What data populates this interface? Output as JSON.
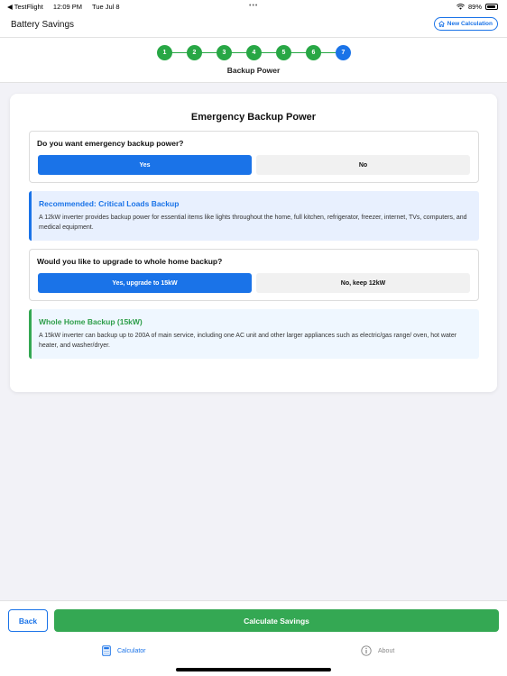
{
  "status_bar": {
    "back_app": "◀ TestFlight",
    "time": "12:09 PM",
    "date": "Tue Jul 8",
    "dots": "•••",
    "battery_pct": "89%",
    "battery_level": 0.89
  },
  "nav": {
    "title": "Battery Savings",
    "new_calc_label": "New Calculation"
  },
  "stepper": {
    "steps": [
      "1",
      "2",
      "3",
      "4",
      "5",
      "6",
      "7"
    ],
    "current_index": 6,
    "current_label": "Backup Power"
  },
  "card": {
    "title": "Emergency Backup Power",
    "q1": {
      "text": "Do you want emergency backup power?",
      "yes": "Yes",
      "no": "No",
      "selected": "Yes"
    },
    "rec": {
      "title": "Recommended: Critical Loads Backup",
      "body": "A 12kW inverter provides backup power for essential items like lights throughout the home, full kitchen, refrigerator, freezer, internet, TVs, computers, and medical equipment."
    },
    "q2": {
      "text": "Would you like to upgrade to whole home backup?",
      "yes": "Yes, upgrade to 15kW",
      "no": "No, keep 12kW",
      "selected": "Yes, upgrade to 15kW"
    },
    "whole": {
      "title": "Whole Home Backup (15kW)",
      "body": "A 15kW inverter can backup up to 200A of main service, including one AC unit and other larger appliances such as electric/gas range/ oven, hot water heater, and washer/dryer."
    }
  },
  "actions": {
    "back": "Back",
    "calculate": "Calculate Savings"
  },
  "tabs": {
    "calculator": "Calculator",
    "about": "About"
  },
  "colors": {
    "primary": "#1a73e8",
    "success": "#34a853",
    "step_done": "#28a745"
  }
}
